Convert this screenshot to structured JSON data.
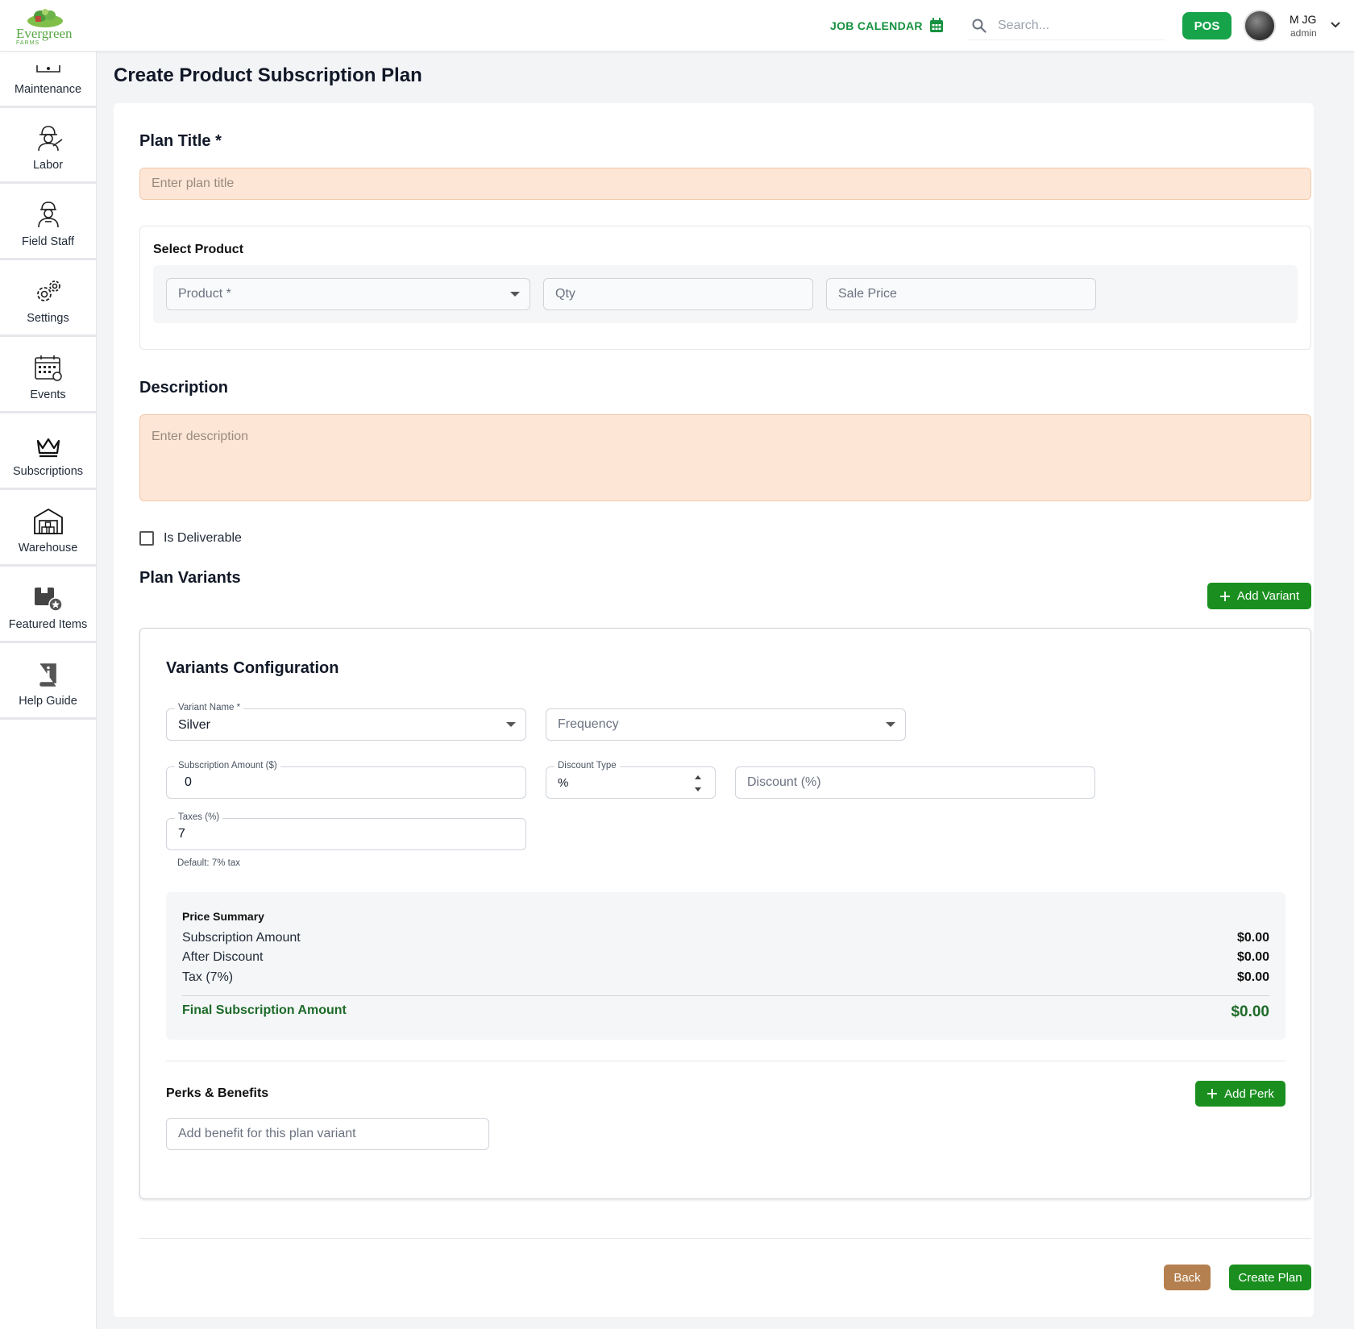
{
  "header": {
    "logo_text": "Evergreen",
    "logo_sub": "FARMS",
    "job_calendar": "JOB CALENDAR",
    "search_placeholder": "Search...",
    "pos": "POS",
    "user_name": "M JG",
    "user_role": "admin"
  },
  "sidebar": {
    "items": [
      {
        "label": "Maintenance",
        "icon": "maintenance-icon"
      },
      {
        "label": "Labor",
        "icon": "labor-icon"
      },
      {
        "label": "Field Staff",
        "icon": "field-staff-icon"
      },
      {
        "label": "Settings",
        "icon": "gear-icon"
      },
      {
        "label": "Events",
        "icon": "calendar-grid-icon"
      },
      {
        "label": "Subscriptions",
        "icon": "crown-icon"
      },
      {
        "label": "Warehouse",
        "icon": "warehouse-icon"
      },
      {
        "label": "Featured Items",
        "icon": "featured-box-icon"
      },
      {
        "label": "Help Guide",
        "icon": "info-book-icon"
      }
    ]
  },
  "page": {
    "title": "Create Product Subscription Plan"
  },
  "form": {
    "plan_title_label": "Plan Title *",
    "plan_title_placeholder": "Enter plan title",
    "select_product_label": "Select Product",
    "product_placeholder": "Product *",
    "qty_placeholder": "Qty",
    "sale_price_placeholder": "Sale Price",
    "description_label": "Description",
    "description_placeholder": "Enter description",
    "is_deliverable_label": "Is Deliverable",
    "is_deliverable_checked": false,
    "plan_variants_label": "Plan Variants",
    "add_variant": "Add Variant"
  },
  "variant": {
    "heading": "Variants Configuration",
    "variant_name_label": "Variant Name *",
    "variant_name_value": "Silver",
    "frequency_placeholder": "Frequency",
    "subscription_amount_label": "Subscription Amount ($)",
    "subscription_amount_value": "0",
    "discount_type_label": "Discount Type",
    "discount_type_value": "%",
    "discount_placeholder": "Discount (%)",
    "taxes_label": "Taxes (%)",
    "taxes_value": "7",
    "taxes_hint": "Default: 7% tax",
    "summary": {
      "heading": "Price Summary",
      "rows": [
        {
          "label": "Subscription Amount",
          "value": "$0.00"
        },
        {
          "label": "After Discount",
          "value": "$0.00"
        },
        {
          "label": "Tax (7%)",
          "value": "$0.00"
        }
      ],
      "final_label": "Final Subscription Amount",
      "final_value": "$0.00"
    },
    "perks_heading": "Perks & Benefits",
    "add_perk": "Add Perk",
    "perk_placeholder": "Add benefit for this plan variant"
  },
  "footer": {
    "back": "Back",
    "create": "Create Plan"
  },
  "colors": {
    "brand_green": "#1a8f1f",
    "pos_green": "#16a34a",
    "peach_input": "#fde6d5",
    "back_brown": "#b5804f",
    "final_green": "#1d6b2a"
  }
}
